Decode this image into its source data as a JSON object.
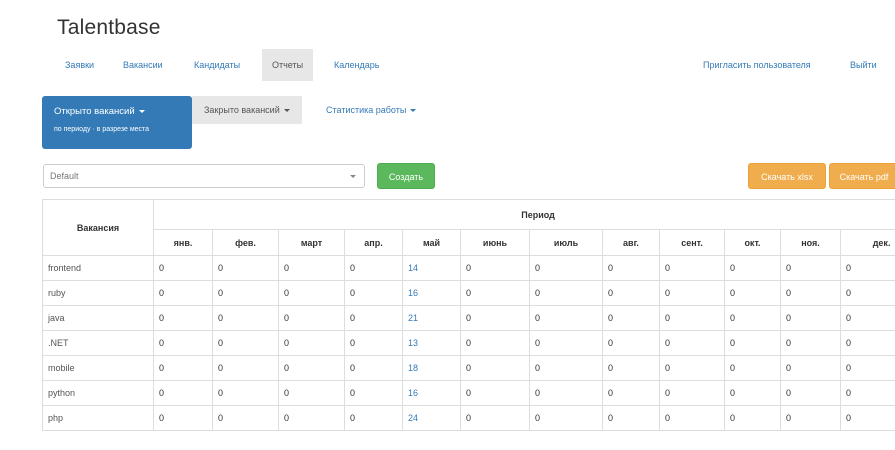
{
  "app": {
    "brand": "Talentbase"
  },
  "nav": {
    "items": [
      {
        "label": "Заявки",
        "active": false
      },
      {
        "label": "Вакансии",
        "active": false
      },
      {
        "label": "Кандидаты",
        "active": false
      },
      {
        "label": "Отчеты",
        "active": true
      },
      {
        "label": "Календарь",
        "active": false
      }
    ],
    "invite_label": "Пригласить пользователя",
    "logout_label": "Выйти"
  },
  "report_tabs": {
    "opened": {
      "label": "Открыто вакансий",
      "sub_label": "по периоду · в разрезе места"
    },
    "closed": {
      "label": "Закрыто вакансий"
    },
    "stats": {
      "label": "Статистика работы"
    }
  },
  "toolbar": {
    "template_select_value": "Default",
    "create_label": "Создать",
    "download_xlsx_label": "Скачать xlsx",
    "download_pdf_label": "Скачать pdf"
  },
  "colors": {
    "primary": "#337ab7",
    "success": "#5cb85c",
    "warning": "#f0ad4e"
  },
  "table": {
    "vacancy_header": "Вакансия",
    "period_header": "Период",
    "months": [
      "янв.",
      "фев.",
      "март",
      "апр.",
      "май",
      "июнь",
      "июль",
      "авг.",
      "сент.",
      "окт.",
      "ноя.",
      "дек."
    ],
    "rows": [
      {
        "vacancy": "frontend",
        "values": [
          "0",
          "0",
          "0",
          "0",
          "14",
          "0",
          "0",
          "0",
          "0",
          "0",
          "0",
          "0"
        ]
      },
      {
        "vacancy": "ruby",
        "values": [
          "0",
          "0",
          "0",
          "0",
          "16",
          "0",
          "0",
          "0",
          "0",
          "0",
          "0",
          "0"
        ]
      },
      {
        "vacancy": "java",
        "values": [
          "0",
          "0",
          "0",
          "0",
          "21",
          "0",
          "0",
          "0",
          "0",
          "0",
          "0",
          "0"
        ]
      },
      {
        "vacancy": ".NET",
        "values": [
          "0",
          "0",
          "0",
          "0",
          "13",
          "0",
          "0",
          "0",
          "0",
          "0",
          "0",
          "0"
        ]
      },
      {
        "vacancy": "mobile",
        "values": [
          "0",
          "0",
          "0",
          "0",
          "18",
          "0",
          "0",
          "0",
          "0",
          "0",
          "0",
          "0"
        ]
      },
      {
        "vacancy": "python",
        "values": [
          "0",
          "0",
          "0",
          "0",
          "16",
          "0",
          "0",
          "0",
          "0",
          "0",
          "0",
          "0"
        ]
      },
      {
        "vacancy": "php",
        "values": [
          "0",
          "0",
          "0",
          "0",
          "24",
          "0",
          "0",
          "0",
          "0",
          "0",
          "0",
          "0"
        ]
      }
    ]
  }
}
